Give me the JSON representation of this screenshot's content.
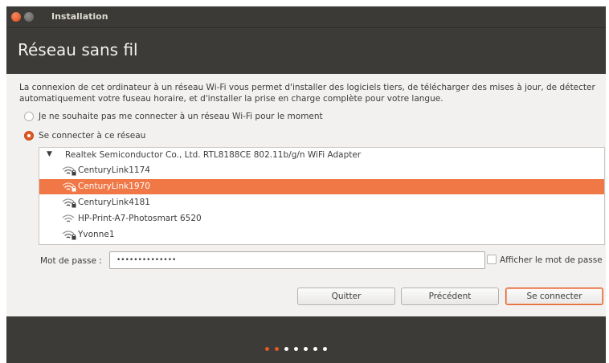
{
  "window": {
    "title": "Installation"
  },
  "page": {
    "title": "Réseau sans fil"
  },
  "intro": "La connexion de cet ordinateur à un réseau Wi-Fi vous permet d'installer des logiciels tiers, de télécharger des mises à jour, de détecter automatiquement votre fuseau horaire, et d'installer la prise en charge complète pour votre langue.",
  "options": {
    "no_connect": {
      "label": "Je ne souhaite pas me connecter à un réseau Wi-Fi pour le moment",
      "checked": false
    },
    "connect": {
      "label": "Se connecter à ce réseau",
      "checked": true
    }
  },
  "networks": {
    "adapter": "Realtek Semiconductor Co., Ltd. RTL8188CE 802.11b/g/n WiFi Adapter",
    "expander": "▼",
    "items": [
      {
        "name": "CenturyLink1174",
        "secured": true,
        "selected": false
      },
      {
        "name": "CenturyLink1970",
        "secured": true,
        "selected": true
      },
      {
        "name": "CenturyLink4181",
        "secured": true,
        "selected": false
      },
      {
        "name": "HP-Print-A7-Photosmart 6520",
        "secured": false,
        "selected": false
      },
      {
        "name": "Yvonne1",
        "secured": true,
        "selected": false
      }
    ]
  },
  "password": {
    "label": "Mot de passe :",
    "value": "••••••••••••••",
    "show_label": "Afficher le mot de passe",
    "show_checked": false
  },
  "buttons": {
    "quit": "Quitter",
    "back": "Précédent",
    "connect": "Se connecter"
  },
  "progress": {
    "total_steps": 7,
    "completed_steps": 2
  },
  "colors": {
    "accent": "#e05a25",
    "selection": "#f07746",
    "header_bg": "#3c3b37"
  }
}
